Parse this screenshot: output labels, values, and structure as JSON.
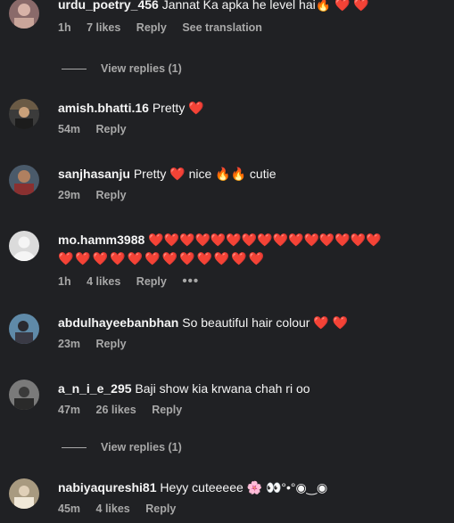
{
  "comments": [
    {
      "username": "urdu_poetry_456",
      "text": "Jannat Ka apka he level hai🔥 ❤️ ❤️",
      "time": "1h",
      "likes": "7 likes",
      "reply": "Reply",
      "translation": "See translation",
      "view_replies": "View replies (1)"
    },
    {
      "username": "amish.bhatti.16",
      "text": "Pretty ❤️",
      "time": "54m",
      "reply": "Reply"
    },
    {
      "username": "sanjhasanju",
      "text": "Pretty ❤️  nice 🔥🔥 cutie",
      "time": "29m",
      "reply": "Reply"
    },
    {
      "username": "mo.hamm3988",
      "text_line1": "❤️❤️❤️❤️❤️❤️❤️❤️❤️❤️❤️❤️❤️❤️❤️",
      "text_line2": "❤️❤️❤️❤️❤️❤️❤️❤️❤️❤️❤️❤️",
      "time": "1h",
      "likes": "4 likes",
      "reply": "Reply",
      "more": "•••"
    },
    {
      "username": "abdulhayeebanbhan",
      "text": "So beautiful hair colour ❤️ ❤️",
      "time": "23m",
      "reply": "Reply"
    },
    {
      "username": "a_n_i_e_295",
      "text": "Baji show kia krwana chah ri oo",
      "time": "47m",
      "likes": "26 likes",
      "reply": "Reply",
      "view_replies": "View replies (1)"
    },
    {
      "username": "nabiyaqureshi81",
      "text": "Heyy cuteeeee 🌸 👀°•°◉‿◉",
      "time": "45m",
      "likes": "4 likes",
      "reply": "Reply"
    }
  ]
}
